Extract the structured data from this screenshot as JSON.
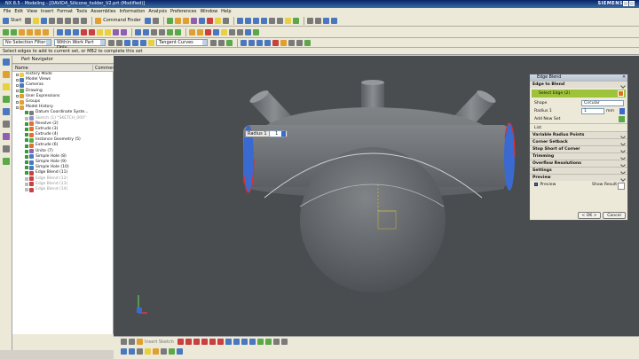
{
  "titlebar": {
    "title": "NX 8.5 - Modeling - [DAVID4_Silicone_holder_V2.prt (Modified)]",
    "brand": "SIEMENS"
  },
  "menu": [
    "File",
    "Edit",
    "View",
    "Insert",
    "Format",
    "Tools",
    "Assemblies",
    "Information",
    "Analysis",
    "Preferences",
    "Window",
    "Help"
  ],
  "toolbar": {
    "start": "Start",
    "command_finder": "Command Finder"
  },
  "selection": {
    "filter": "No Selection Filter",
    "scope": "Within Work Part Only",
    "curve_rule": "Tangent Curves"
  },
  "cue": "Select edges to add to current set, or MB2 to complete this set",
  "navigator": {
    "title": "Part Navigator",
    "col_name": "Name",
    "col_comment": "Comment",
    "items": [
      {
        "label": "History Mode",
        "dim": false
      },
      {
        "label": "Model Views",
        "dim": false
      },
      {
        "label": "Cameras",
        "dim": false
      },
      {
        "label": "Drawing",
        "dim": false
      },
      {
        "label": "User Expressions",
        "dim": false
      },
      {
        "label": "Groups",
        "dim": false
      },
      {
        "label": "Model History",
        "dim": false
      },
      {
        "label": "Datum Coordinate Syste...",
        "dim": false
      },
      {
        "label": "Sketch (1) \"SKETCH_000\"",
        "dim": true
      },
      {
        "label": "Revolve (2)",
        "dim": false
      },
      {
        "label": "Extrude (3)",
        "dim": false
      },
      {
        "label": "Extrude (4)",
        "dim": false
      },
      {
        "label": "Instance Geometry (5)",
        "dim": false
      },
      {
        "label": "Extrude (6)",
        "dim": false
      },
      {
        "label": "Unite (7)",
        "dim": false
      },
      {
        "label": "Simple Hole (8)",
        "dim": false
      },
      {
        "label": "Simple Hole (9)",
        "dim": false
      },
      {
        "label": "Simple Hole (10)",
        "dim": false
      },
      {
        "label": "Edge Blend (11)",
        "dim": false
      },
      {
        "label": "Edge Blend (12)",
        "dim": true
      },
      {
        "label": "Edge Blend (13)",
        "dim": true
      },
      {
        "label": "Edge Blend (14)",
        "dim": true
      }
    ]
  },
  "dialog": {
    "title": "Edge Blend",
    "edge_to_blend": "Edge to Blend",
    "select_edge": "Select Edge (2)",
    "shape_label": "Shape",
    "shape_value": "Circular",
    "radius_label": "Radius 1",
    "radius_value": "1",
    "radius_unit": "mm",
    "add_new_set": "Add New Set",
    "list": "List",
    "sections": [
      "Variable Radius Points",
      "Corner Setback",
      "Stop Short of Corner",
      "Trimming",
      "Overflow Resolutions",
      "Settings",
      "Preview"
    ],
    "preview_label": "Preview",
    "show_result": "Show Result",
    "ok": "< OK >",
    "cancel": "Cancel"
  },
  "viewport_label": {
    "text": "Radius 1",
    "value": "1"
  },
  "sketch": {
    "label": "Insert Sketch"
  },
  "colors": {
    "accent_green": "#9ec23a",
    "viewport_bg": "#4a4d50",
    "edge_red": "#d83030",
    "edge_blue": "#3a6ad0"
  }
}
